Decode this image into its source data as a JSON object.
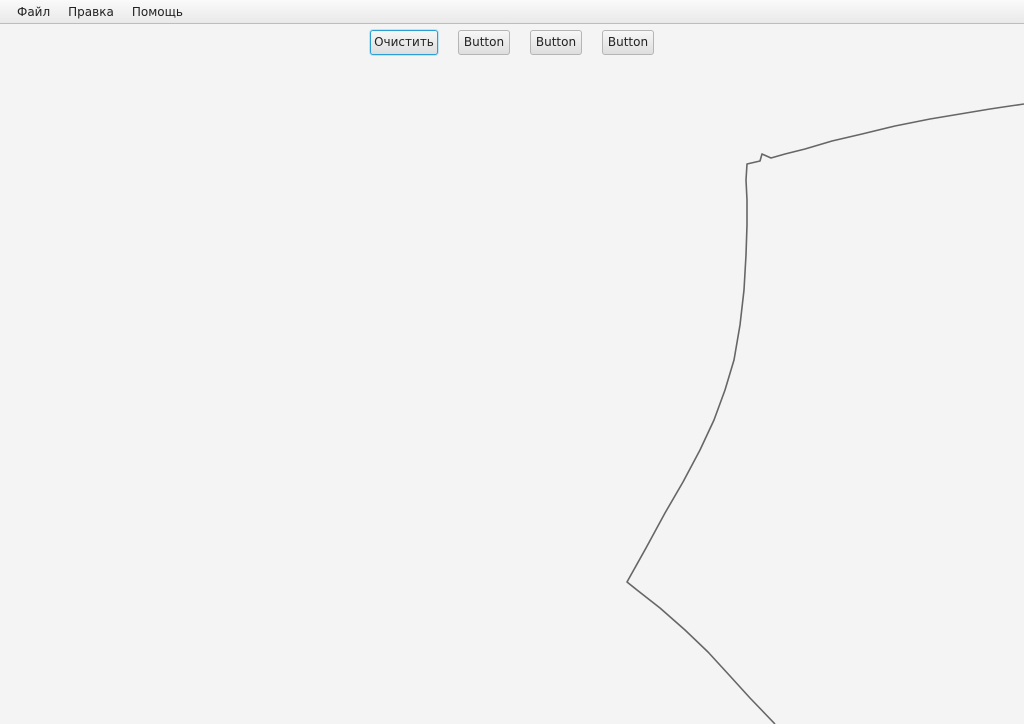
{
  "menu": {
    "items": [
      {
        "label": "Файл"
      },
      {
        "label": "Правка"
      },
      {
        "label": "Помощь"
      }
    ]
  },
  "toolbar": {
    "clear_label": "Очистить",
    "button1_label": "Button",
    "button2_label": "Button",
    "button3_label": "Button"
  },
  "drawing": {
    "stroke_color": "#666666"
  }
}
